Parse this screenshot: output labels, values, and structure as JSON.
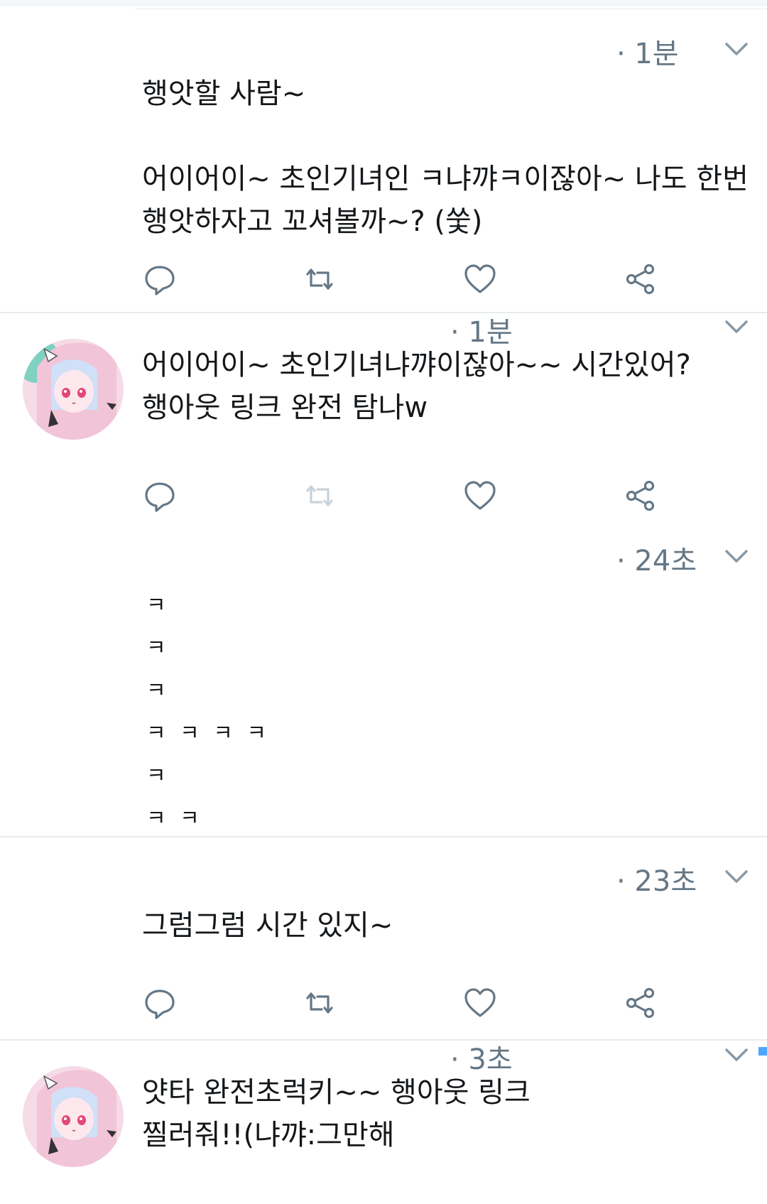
{
  "tweets": [
    {
      "time": "· 1분",
      "text": "행앗할 사람~\n\n어이어이~ 초인기녀인 ㅋ냐꺄ㅋ이잖아~ 나도 한번\n행앗하자고 꼬셔볼까~? (쑻)"
    },
    {
      "time": "· 1분",
      "text": "어이어이~ 초인기녀냐꺄이잖아~~ 시간있어?\n행아웃 링크 완전 탐나w"
    },
    {
      "time": "· 24초",
      "lines": [
        "ㅋ",
        "ㅋ",
        "ㅋ",
        "ㅋ ㅋ ㅋ ㅋ",
        "ㅋ",
        "ㅋ ㅋ"
      ]
    },
    {
      "time": "· 23초",
      "text": "그럼그럼 시간 있지~"
    },
    {
      "time": "· 3초",
      "text": "얏타 완전초럭키~~ 행아웃 링크\n찔러줘!!(냐꺄:그만해"
    }
  ],
  "icons": {
    "reply": "reply-icon",
    "retweet": "retweet-icon",
    "like": "like-icon",
    "share": "share-icon",
    "caret": "chevron-down-icon"
  },
  "colors": {
    "text": "#14171a",
    "meta": "#657786",
    "icon": "#657786",
    "icon_disabled": "#c8d2da",
    "separator": "#e6ecf0",
    "accent": "#4da6ff"
  }
}
